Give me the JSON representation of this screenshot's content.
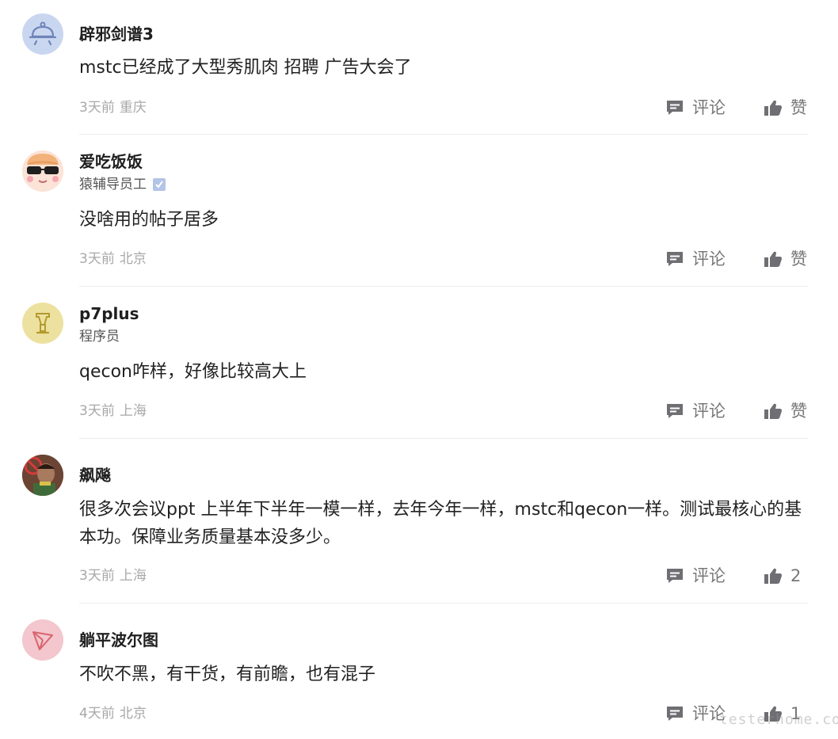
{
  "comments": [
    {
      "avatar_icon": "bell-tray-icon",
      "username": "辟邪剑谱3",
      "role": "",
      "verified": false,
      "content": "mstc已经成了大型秀肌肉 招聘 广告大会了",
      "time": "3天前",
      "location": "重庆",
      "reply_label": "评论",
      "like_label": "赞"
    },
    {
      "avatar_icon": "cartoon-sunglasses-avatar-icon",
      "username": "爱吃饭饭",
      "role": "猿辅导员工",
      "verified": true,
      "content": "没啥用的帖子居多",
      "time": "3天前",
      "location": "北京",
      "reply_label": "评论",
      "like_label": "赞"
    },
    {
      "avatar_icon": "trophy-icon",
      "username": "p7plus",
      "role": "程序员",
      "verified": false,
      "content": "qecon咋样，好像比较高大上",
      "time": "3天前",
      "location": "上海",
      "reply_label": "评论",
      "like_label": "赞"
    },
    {
      "avatar_icon": "photo-avatar-icon",
      "username": "飙飚",
      "role": "",
      "verified": false,
      "content": "很多次会议ppt 上半年下半年一模一样，去年今年一样，mstc和qecon一样。测试最核心的基本功。保障业务质量基本没多少。",
      "time": "3天前",
      "location": "上海",
      "reply_label": "评论",
      "like_label": "2"
    },
    {
      "avatar_icon": "paper-plane-icon",
      "username": "躺平波尔图",
      "role": "",
      "verified": false,
      "content": "不吹不黑，有干货，有前瞻，也有混子",
      "time": "4天前",
      "location": "北京",
      "reply_label": "评论",
      "like_label": "1"
    }
  ],
  "watermark": "testerhome.com",
  "colors": {
    "meta_text": "#a8a8a8",
    "action_icon": "#6e6e73",
    "divider": "#ececec",
    "verified_badge": "#b4c4e6"
  }
}
